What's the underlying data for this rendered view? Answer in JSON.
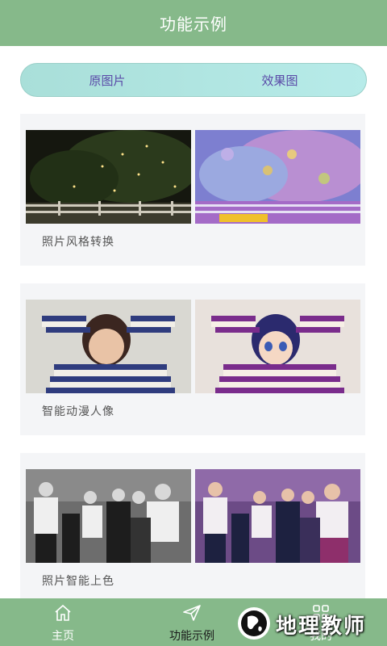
{
  "header": {
    "title": "功能示例"
  },
  "toggle": {
    "original_label": "原图片",
    "effect_label": "效果图"
  },
  "cards": [
    {
      "caption": "照片风格转换"
    },
    {
      "caption": "智能动漫人像"
    },
    {
      "caption": "照片智能上色"
    }
  ],
  "tabbar": {
    "tabs": [
      {
        "label": "主页",
        "icon": "home-icon"
      },
      {
        "label": "功能示例",
        "icon": "send-icon"
      },
      {
        "label": "我的",
        "icon": "grid-icon"
      }
    ]
  },
  "watermark": {
    "text": "地理教师"
  },
  "colors": {
    "accent": "#86b98a",
    "toggle": "#b7ebe9",
    "toggle_text": "#5a4aa8",
    "card_bg": "#f4f5f7"
  }
}
